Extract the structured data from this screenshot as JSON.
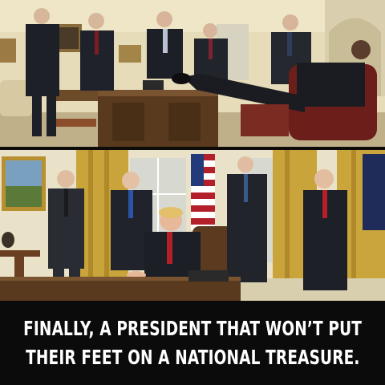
{
  "caption": {
    "line1": "FINALLY, A PRESIDENT THAT WON’T PUT",
    "line2": "THEIR FEET ON A NATIONAL TREASURE."
  },
  "colors": {
    "background": "#0d0c0b",
    "caption_text": "#ffffff",
    "gold_drapes": "#c9a43a",
    "oval_office_wall": "#e8dcb6",
    "desk_wood": "#5a3a1e",
    "dark_suit": "#1d1f26",
    "red_tie": "#b3202a",
    "blue_tie": "#2d53a8"
  }
}
